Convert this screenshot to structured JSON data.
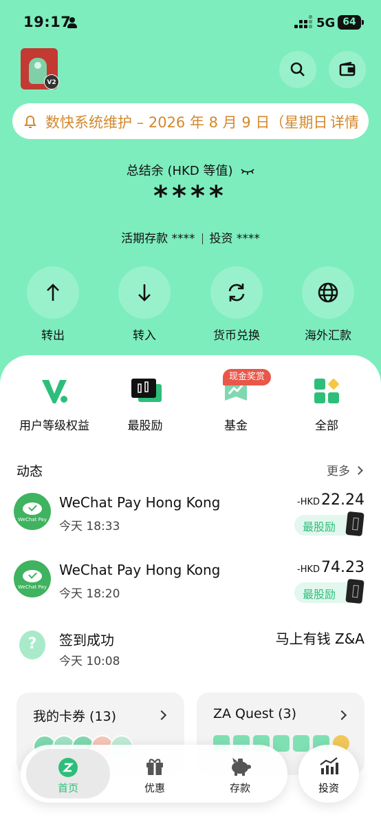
{
  "status_bar": {
    "time": "19:17",
    "network": "5G",
    "battery": "64"
  },
  "notice": {
    "text": "数快系统维护 – 2026 年 8 月 9 日（星期日）",
    "more": "详情"
  },
  "balance": {
    "label": "总结余 (HKD 等值)",
    "value": "****",
    "savings_label": "活期存款",
    "savings_value": "****",
    "invest_label": "投资",
    "invest_value": "****"
  },
  "actions": [
    {
      "label": "转出",
      "icon": "arrow-up-icon"
    },
    {
      "label": "转入",
      "icon": "arrow-down-icon"
    },
    {
      "label": "货币兑换",
      "icon": "exchange-icon"
    },
    {
      "label": "海外汇款",
      "icon": "globe-icon"
    }
  ],
  "shortcuts": [
    {
      "label": "用户等级权益",
      "icon": "tier-icon"
    },
    {
      "label": "最股励",
      "icon": "stock-reward-icon"
    },
    {
      "label": "基金",
      "icon": "fund-icon",
      "badge": "现金奖赏"
    },
    {
      "label": "全部",
      "icon": "all-apps-icon"
    }
  ],
  "activity": {
    "title": "动态",
    "more": "更多",
    "items": [
      {
        "name": "WeChat Pay Hong Kong",
        "time": "今天 18:33",
        "currency": "-HKD",
        "amount": "22.24",
        "tag": "最股励",
        "logo_text": "WeChat Pay"
      },
      {
        "name": "WeChat Pay Hong Kong",
        "time": "今天 18:20",
        "currency": "-HKD",
        "amount": "74.23",
        "tag": "最股励",
        "logo_text": "WeChat Pay"
      },
      {
        "name": "签到成功",
        "time": "今天 10:08",
        "merchant": "马上有钱 Z&A"
      }
    ]
  },
  "cards": [
    {
      "title": "我的卡券 (13)"
    },
    {
      "title": "ZA Quest (3)"
    }
  ],
  "tabs": [
    {
      "label": "首页",
      "icon": "home-icon",
      "active": true
    },
    {
      "label": "优惠",
      "icon": "gift-icon"
    },
    {
      "label": "存款",
      "icon": "piggy-bank-icon"
    },
    {
      "label": "投资",
      "icon": "chart-icon"
    }
  ],
  "colors": {
    "background": "#7DEDBD",
    "accent": "#2DBE7A",
    "notice": "#D4882A",
    "badge": "#E9574A"
  }
}
